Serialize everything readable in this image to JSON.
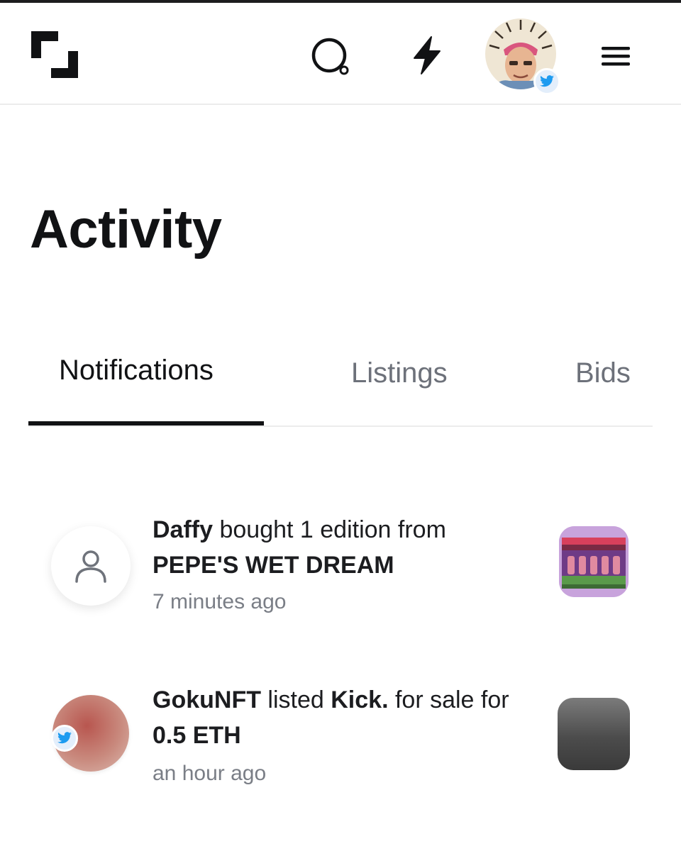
{
  "header": {
    "icons": {
      "logo": "foundation-logo-icon",
      "search": "search-icon",
      "activity": "lightning-bolt-icon",
      "avatar_badge": "twitter-icon",
      "menu": "hamburger-menu-icon"
    }
  },
  "page": {
    "title": "Activity"
  },
  "tabs": [
    {
      "label": "Notifications",
      "active": true
    },
    {
      "label": "Listings",
      "active": false
    },
    {
      "label": "Bids",
      "active": false
    }
  ],
  "notifications": [
    {
      "actor": "Daffy",
      "action": " bought 1 edition from ",
      "target": "PEPE'S WET DREAM",
      "time": "7 minutes ago",
      "avatar_icon": "user-placeholder-icon"
    },
    {
      "actor": "GokuNFT",
      "action": " listed ",
      "target": "Kick.",
      "action_2": " for sale for ",
      "price": "0.5 ETH",
      "time": "an hour ago",
      "avatar_badge": "twitter-icon"
    }
  ],
  "colors": {
    "text_primary": "#111214",
    "text_secondary": "#6d717a",
    "twitter_blue": "#1d9bf0",
    "divider": "#ececec"
  }
}
